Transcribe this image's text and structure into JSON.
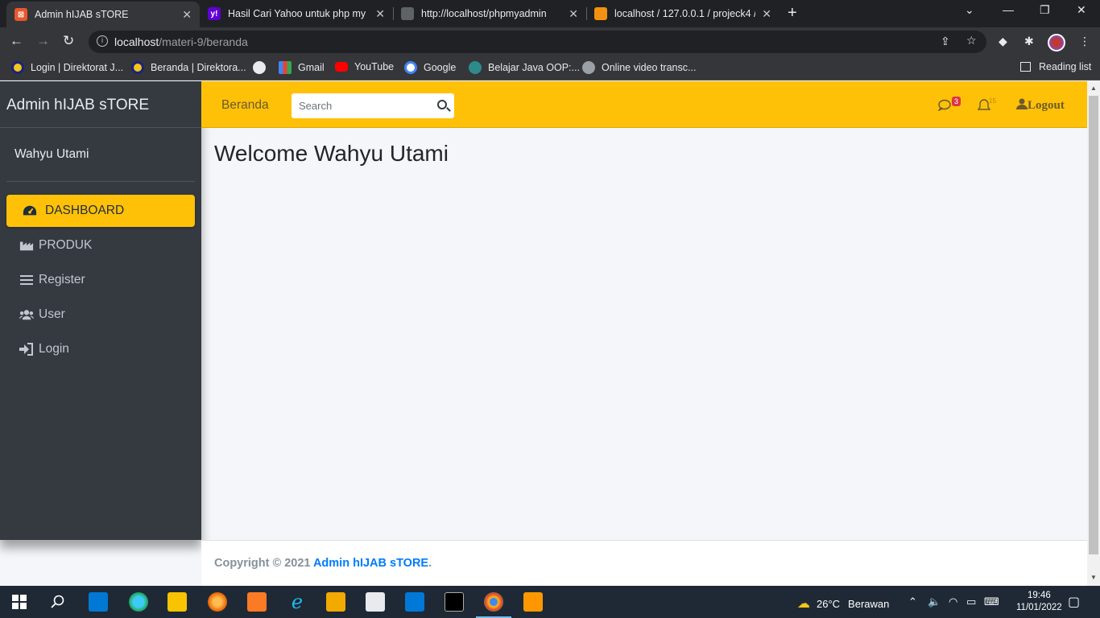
{
  "browser": {
    "tabs": [
      {
        "title": "Admin hIJAB sTORE",
        "active": true
      },
      {
        "title": "Hasil Cari Yahoo untuk php my ad",
        "active": false
      },
      {
        "title": "http://localhost/phpmyadmin",
        "active": false
      },
      {
        "title": "localhost / 127.0.0.1 / projeck4 /",
        "active": false
      }
    ],
    "url_host": "localhost",
    "url_path": "/materi-9/beranda",
    "bookmarks": [
      {
        "label": "Login | Direktorat J..."
      },
      {
        "label": "Beranda | Direktora..."
      },
      {
        "label": ""
      },
      {
        "label": "Gmail"
      },
      {
        "label": "YouTube"
      },
      {
        "label": "Google"
      },
      {
        "label": "Belajar Java OOP:..."
      },
      {
        "label": "Online video transc..."
      }
    ],
    "reading_list": "Reading list"
  },
  "sidebar": {
    "brand": "Admin hIJAB sTORE",
    "user_name": "Wahyu Utami",
    "items": [
      {
        "label": "DASHBOARD",
        "icon": "tachometer-icon",
        "active": true
      },
      {
        "label": "PRODUK",
        "icon": "industry-icon",
        "active": false
      },
      {
        "label": "Register",
        "icon": "bars-icon",
        "active": false
      },
      {
        "label": "User",
        "icon": "users-icon",
        "active": false
      },
      {
        "label": "Login",
        "icon": "sign-in-icon",
        "active": false
      }
    ]
  },
  "navbar": {
    "home_link": "Beranda",
    "search_placeholder": "Search",
    "messages_badge": "3",
    "notifications_badge": "15",
    "logout_label": "Logout"
  },
  "content": {
    "title": "Welcome Wahyu Utami"
  },
  "footer": {
    "prefix": "Copyright © 2021 ",
    "brand": "Admin hIJAB sTORE",
    "suffix": "."
  },
  "taskbar": {
    "temperature": "26°C",
    "weather": "Berawan",
    "time": "19:46",
    "date": "11/01/2022"
  },
  "colors": {
    "accent": "#ffc107",
    "sidebar": "#343a40",
    "link": "#007bff",
    "badge": "#dc3545"
  }
}
